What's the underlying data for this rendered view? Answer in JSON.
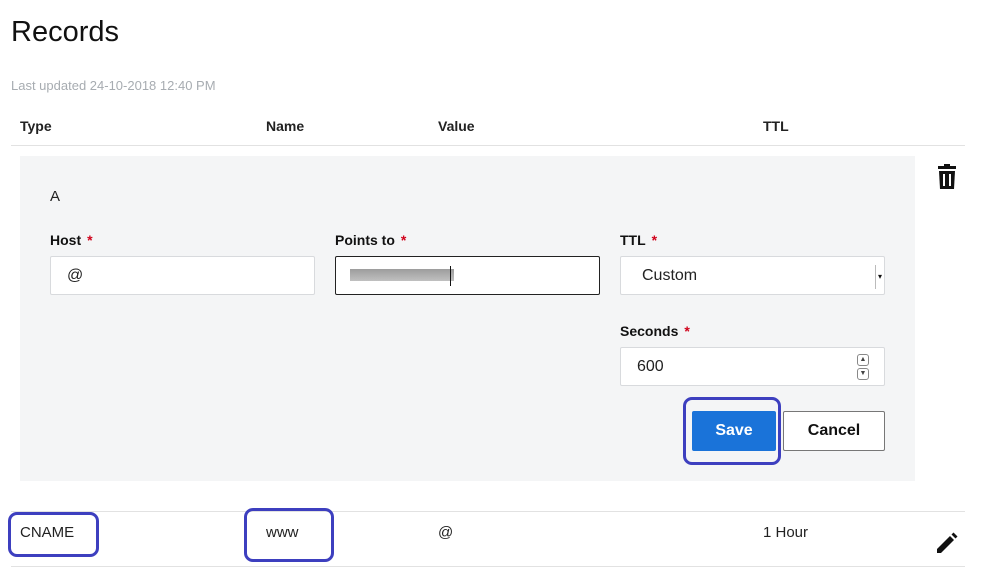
{
  "page": {
    "title": "Records",
    "last_updated": "Last updated 24-10-2018 12:40 PM"
  },
  "table": {
    "columns": [
      "Type",
      "Name",
      "Value",
      "TTL"
    ]
  },
  "edit_form": {
    "record_type": "A",
    "host": {
      "label": "Host",
      "required_mark": "*",
      "value": "@"
    },
    "points_to": {
      "label": "Points to",
      "required_mark": "*",
      "value": ""
    },
    "ttl": {
      "label": "TTL",
      "required_mark": "*",
      "selected": "Custom"
    },
    "seconds": {
      "label": "Seconds",
      "required_mark": "*",
      "value": "600"
    },
    "save_label": "Save",
    "cancel_label": "Cancel"
  },
  "records": [
    {
      "type": "CNAME",
      "name": "www",
      "value": "@",
      "ttl": "1 Hour"
    }
  ],
  "icons": {
    "delete": "trash-icon",
    "edit": "pencil-icon"
  },
  "colors": {
    "save_button": "#1a73d9",
    "highlight": "#3d3fbf",
    "required": "#d0021b",
    "panel_bg": "#f4f5f6"
  }
}
